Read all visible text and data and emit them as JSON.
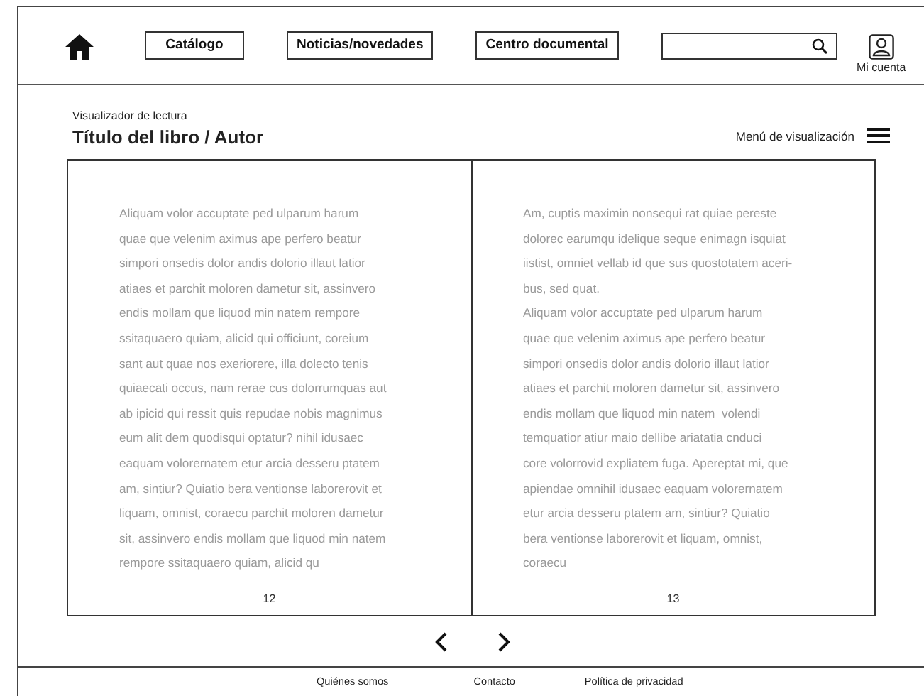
{
  "header": {
    "nav": [
      {
        "label": "Catálogo"
      },
      {
        "label": "Noticias/novedades"
      },
      {
        "label": "Centro documental"
      }
    ],
    "account": {
      "label": "Mi cuenta"
    }
  },
  "reader": {
    "caption": "Visualizador de lectura",
    "title": "Título del libro / Autor",
    "menu_label": "Menú de visualización"
  },
  "pages": [
    {
      "paragraphs": [
        "Aliquam volor accuptate ped ulparum harum\nquae que velenim aximus ape perfero beatur\nsimpori onsedis dolor andis dolorio illaut latior\natiaes et parchit moloren dametur sit, assinvero\nendis mollam que liquod min natem rempore\nssitaquaero quiam, alicid qui officiunt, coreium\nsant aut quae nos exeriorere, illa dolecto tenis\nquiaecati occus, nam rerae cus dolorrumquas aut\nab ipicid qui ressit quis repudae nobis magnimus\neum alit dem quodisqui optatur? nihil idusaec\neaquam volorernatem etur arcia desseru ptatem\nam, sintiur? Quiatio bera ventionse laborerovit et\nliquam, omnist, coraecu parchit moloren dametur\nsit, assinvero endis mollam que liquod min natem\nrempore ssitaquaero quiam, alicid qu"
      ],
      "number": "12"
    },
    {
      "paragraphs": [
        "Am, cuptis maximin nonsequi rat quiae pereste\ndolorec earumqu idelique seque enimagn isquiat\niistist, omniet vellab id que sus quostotatem aceri-\nbus, sed quat.",
        "Aliquam volor accuptate ped ulparum harum\nquae que velenim aximus ape perfero beatur\nsimpori onsedis dolor andis dolorio illaut latior\natiaes et parchit moloren dametur sit, assinvero\nendis mollam que liquod min natem  volendi\ntemquatior atiur maio dellibe ariatatia cnduci\ncore volorrovid expliatem fuga. Apereptat mi, que\napiendae omnihil idusaec eaquam volorernatem\netur arcia desseru ptatem am, sintiur? Quiatio\nbera ventionse laborerovit et liquam, omnist,\ncoraecu"
      ],
      "number": "13"
    }
  ],
  "footer": {
    "links": [
      "Quiénes somos",
      "Contacto",
      "Política de privacidad"
    ]
  }
}
